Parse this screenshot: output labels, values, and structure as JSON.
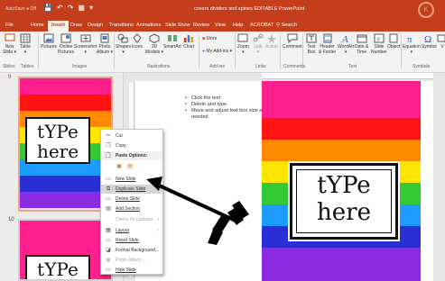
{
  "titlebar": {
    "autosave": "AutoSave ● Off",
    "qat": [
      "💾",
      "↶",
      "↷",
      "▦",
      "▾"
    ],
    "doc_title": "covers dividers and spines EDITABLE PowerPoint"
  },
  "tabs": [
    "File",
    "Home",
    "Insert",
    "Draw",
    "Design",
    "Transitions",
    "Animations",
    "Slide Show",
    "Review",
    "View",
    "Help",
    "ACROBAT",
    "Search"
  ],
  "active_tab": "Insert",
  "ribbon": {
    "buttons": [
      {
        "label": "New\nSlide ▾",
        "icon": "new-slide-icon"
      },
      {
        "label": "Table\n▾",
        "icon": "table-icon"
      },
      {
        "label": "Pictures",
        "icon": "pictures-icon"
      },
      {
        "label": "Online\nPictures",
        "icon": "online-pictures-icon"
      },
      {
        "label": "Screenshot\n▾",
        "icon": "screenshot-icon"
      },
      {
        "label": "Photo\nAlbum ▾",
        "icon": "photo-album-icon"
      },
      {
        "label": "Shapes\n▾",
        "icon": "shapes-icon"
      },
      {
        "label": "Icons",
        "icon": "icons-icon"
      },
      {
        "label": "3D\nModels ▾",
        "icon": "3d-models-icon"
      },
      {
        "label": "SmartArt",
        "icon": "smartart-icon"
      },
      {
        "label": "Chart",
        "icon": "chart-icon"
      },
      {
        "label": "Store",
        "icon": "store-icon"
      },
      {
        "label": "My Add-ins ▾",
        "icon": "my-addins-icon"
      },
      {
        "label": "Zoom\n▾",
        "icon": "zoom-icon"
      },
      {
        "label": "Link\n▾",
        "icon": "link-icon"
      },
      {
        "label": "Action",
        "icon": "action-icon"
      },
      {
        "label": "Comment",
        "icon": "comment-icon"
      },
      {
        "label": "Text\nBox",
        "icon": "text-box-icon"
      },
      {
        "label": "Header\n& Footer",
        "icon": "header-footer-icon"
      },
      {
        "label": "WordArt\n▾",
        "icon": "wordart-icon"
      },
      {
        "label": "Date &\nTime",
        "icon": "date-time-icon"
      },
      {
        "label": "Slide\nNumber",
        "icon": "slide-number-icon"
      },
      {
        "label": "Object",
        "icon": "object-icon"
      },
      {
        "label": "Equation\n▾",
        "icon": "equation-icon"
      },
      {
        "label": "Symbol",
        "icon": "symbol-icon"
      },
      {
        "label": "V",
        "icon": "video-icon"
      }
    ],
    "groups": [
      "Slides",
      "Tables",
      "Images",
      "Illustrations",
      "Add-ins",
      "Links",
      "Comments",
      "Text",
      "Symbols"
    ]
  },
  "slides_pane": {
    "slide_numbers": [
      "9",
      "10"
    ],
    "card_text_line1": "tYPe",
    "card_text_line2": "here"
  },
  "notes": [
    "Click the text",
    "Delete and type",
    "Move and adjust text box size as needed"
  ],
  "main_slide": {
    "card_text_line1": "tYPe",
    "card_text_line2": "here"
  },
  "context_menu": {
    "items": [
      {
        "label": "Cut",
        "icon": "cut-icon",
        "state": "normal"
      },
      {
        "label": "Copy",
        "icon": "copy-icon",
        "state": "normal"
      },
      {
        "label": "Paste Options:",
        "icon": "paste-icon",
        "state": "header"
      },
      {
        "label": "",
        "icon": "paste-option-icon",
        "state": "paste-row"
      },
      {
        "label": "New Slide",
        "icon": "new-slide-icon",
        "state": "normal"
      },
      {
        "label": "Duplicate Slide",
        "icon": "duplicate-slide-icon",
        "state": "highlighted"
      },
      {
        "label": "Delete Slide",
        "icon": "delete-slide-icon",
        "state": "normal"
      },
      {
        "label": "Add Section",
        "icon": "add-section-icon",
        "state": "normal"
      },
      {
        "label": "Check for Updates",
        "icon": "",
        "state": "disabled",
        "submenu": true
      },
      {
        "label": "Layout",
        "icon": "layout-icon",
        "state": "normal",
        "submenu": true
      },
      {
        "label": "Reset Slide",
        "icon": "reset-slide-icon",
        "state": "normal"
      },
      {
        "label": "Format Background...",
        "icon": "format-background-icon",
        "state": "normal"
      },
      {
        "label": "Photo Album...",
        "icon": "photo-album-icon",
        "state": "disabled"
      },
      {
        "label": "Hide Slide",
        "icon": "hide-slide-icon",
        "state": "normal"
      }
    ]
  },
  "colors": {
    "accent": "#c43e1c",
    "stripes": [
      "#ff1f8f",
      "#ff1414",
      "#ff8a00",
      "#ffe600",
      "#35c936",
      "#1e9bff",
      "#2b2fd6",
      "#8a2be2",
      "#ff1f8f"
    ]
  }
}
